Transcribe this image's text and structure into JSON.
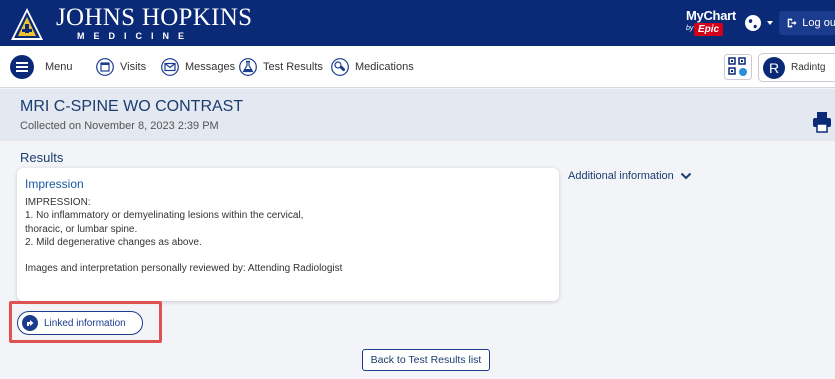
{
  "header": {
    "logo_title": "JOHNS HOPKINS",
    "logo_subtitle": "MEDICINE",
    "mychart_label": "MyChart",
    "mychart_by": "by",
    "epic_label": "Epic",
    "logout_label": "Log out"
  },
  "nav": {
    "items": [
      {
        "label": "Menu",
        "icon": "hamburger-icon"
      },
      {
        "label": "Visits",
        "icon": "calendar-icon"
      },
      {
        "label": "Messages",
        "icon": "envelope-icon"
      },
      {
        "label": "Test Results",
        "icon": "flask-icon"
      },
      {
        "label": "Medications",
        "icon": "pill-icon"
      }
    ],
    "user_initial": "R",
    "user_name": "Radintg"
  },
  "page": {
    "title": "MRI C-SPINE WO CONTRAST",
    "collected": "Collected on November 8, 2023 2:39 PM"
  },
  "results": {
    "heading": "Results",
    "impression_title": "Impression",
    "impression_lines": [
      "IMPRESSION:",
      "1. No inflammatory or demyelinating lesions within the cervical,",
      "thoracic, or lumbar spine.",
      "2. Mild degenerative changes as above.",
      "",
      "Images and interpretation personally reviewed by: Attending Radiologist"
    ],
    "additional_info": "Additional information",
    "linked_info": "Linked information",
    "back_button": "Back to Test Results list"
  },
  "colors": {
    "header_bg": "#0a2a78",
    "accent": "#1b3c8e",
    "highlight": "#e05252"
  }
}
